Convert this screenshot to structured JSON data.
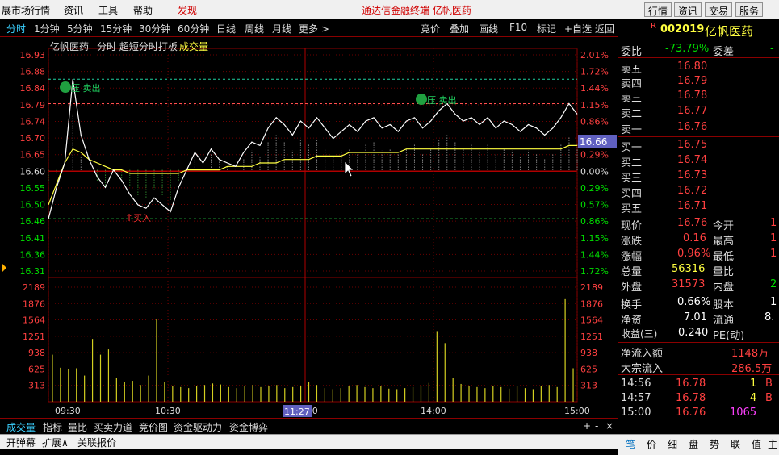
{
  "menubar": {
    "items": [
      "展市场行情",
      "资讯",
      "工具",
      "帮助",
      "发现"
    ],
    "title": "通达信金融终端  亿帆医药",
    "buttons": [
      "行情",
      "资讯",
      "交易",
      "服务"
    ]
  },
  "periods": [
    "分时",
    "1分钟",
    "5分钟",
    "15分钟",
    "30分钟",
    "60分钟",
    "日线",
    "周线",
    "月线",
    "更多 >"
  ],
  "toolbar": [
    "竞价",
    "叠加",
    "画线",
    "F10",
    "标记",
    "+自选",
    "返回"
  ],
  "chart": {
    "stock_name": "亿帆医药",
    "view_label": "分时 超短分时打板",
    "volume_label": "成交量",
    "current_price_tag": "16.66",
    "cursor_time_tag": "11:27",
    "annotations": [
      "压  卖出",
      "买入",
      "压  卖出"
    ]
  },
  "chart_data": {
    "type": "line",
    "price_axis": [
      "16.93",
      "16.88",
      "16.84",
      "16.79",
      "16.74",
      "16.70",
      "16.65",
      "16.60",
      "16.55",
      "16.50",
      "16.46",
      "16.41",
      "16.36",
      "16.31"
    ],
    "pct_axis": [
      "2.01%",
      "1.72%",
      "1.44%",
      "1.15%",
      "0.86%",
      "0.57%",
      "0.29%",
      "0.00%",
      "0.29%",
      "0.57%",
      "0.86%",
      "1.15%",
      "1.44%",
      "1.72%"
    ],
    "volume_axis": [
      "2189",
      "1876",
      "1564",
      "1251",
      "938",
      "625",
      "313"
    ],
    "time_axis": [
      "09:30",
      "10:30",
      "13:00",
      "14:00",
      "15:00"
    ],
    "ylim": [
      16.31,
      16.93
    ],
    "pre_close": 16.6,
    "price": [
      16.46,
      16.55,
      16.62,
      16.86,
      16.7,
      16.63,
      16.58,
      16.55,
      16.6,
      16.57,
      16.53,
      16.5,
      16.49,
      16.52,
      16.5,
      16.48,
      16.55,
      16.6,
      16.65,
      16.62,
      16.66,
      16.63,
      16.62,
      16.61,
      16.65,
      16.68,
      16.67,
      16.72,
      16.75,
      16.73,
      16.7,
      16.74,
      16.72,
      16.75,
      16.72,
      16.69,
      16.71,
      16.73,
      16.71,
      16.74,
      16.75,
      16.72,
      16.73,
      16.71,
      16.74,
      16.75,
      16.72,
      16.74,
      16.77,
      16.79,
      16.76,
      16.74,
      16.75,
      16.73,
      16.75,
      16.72,
      16.74,
      16.73,
      16.71,
      16.73,
      16.72,
      16.7,
      16.72,
      16.75,
      16.79,
      16.76
    ],
    "avg_price": [
      16.5,
      16.56,
      16.62,
      16.66,
      16.65,
      16.63,
      16.62,
      16.61,
      16.6,
      16.6,
      16.59,
      16.59,
      16.59,
      16.59,
      16.59,
      16.59,
      16.59,
      16.6,
      16.6,
      16.6,
      16.6,
      16.6,
      16.61,
      16.61,
      16.61,
      16.61,
      16.62,
      16.62,
      16.62,
      16.63,
      16.63,
      16.63,
      16.63,
      16.64,
      16.64,
      16.64,
      16.64,
      16.65,
      16.65,
      16.65,
      16.65,
      16.65,
      16.65,
      16.65,
      16.66,
      16.66,
      16.66,
      16.66,
      16.66,
      16.66,
      16.66,
      16.66,
      16.66,
      16.66,
      16.66,
      16.66,
      16.66,
      16.66,
      16.66,
      16.66,
      16.66,
      16.66,
      16.66,
      16.66,
      16.67,
      16.67
    ],
    "volume": [
      900,
      650,
      620,
      640,
      500,
      1200,
      900,
      1000,
      450,
      380,
      400,
      320,
      500,
      1580,
      380,
      300,
      280,
      260,
      300,
      320,
      350,
      330,
      280,
      260,
      300,
      320,
      280,
      300,
      320,
      260,
      280,
      300,
      380,
      320,
      260,
      240,
      260,
      300,
      320,
      280,
      260,
      300,
      250,
      240,
      260,
      280,
      300,
      360,
      1350,
      1120,
      460,
      340,
      300,
      280,
      260,
      300,
      280,
      250,
      300,
      260,
      240,
      300,
      320,
      280,
      1960,
      640
    ]
  },
  "bottom_tabs": [
    "成交量",
    "指标",
    "量比",
    "买卖力道",
    "竞价图",
    "资金驱动力",
    "资金博弈"
  ],
  "bottom_tabs2": [
    "开弹幕",
    "扩展∧",
    "关联报价"
  ],
  "quote": {
    "flag": "R",
    "code": "002019",
    "name": "亿帆医药",
    "weibi_label": "委比",
    "weibi_value": "-73.79%",
    "weicha_label": "委差",
    "weicha_value": "-",
    "sell": [
      {
        "label": "卖五",
        "price": "16.80"
      },
      {
        "label": "卖四",
        "price": "16.79"
      },
      {
        "label": "卖三",
        "price": "16.78"
      },
      {
        "label": "卖二",
        "price": "16.77"
      },
      {
        "label": "卖一",
        "price": "16.76"
      }
    ],
    "buy": [
      {
        "label": "买一",
        "price": "16.75"
      },
      {
        "label": "买二",
        "price": "16.74"
      },
      {
        "label": "买三",
        "price": "16.73"
      },
      {
        "label": "买四",
        "price": "16.72"
      },
      {
        "label": "买五",
        "price": "16.71"
      }
    ],
    "stats": [
      {
        "label": "现价",
        "value": "16.76",
        "label2": "今开",
        "value2": "1"
      },
      {
        "label": "涨跌",
        "value": "0.16",
        "label2": "最高",
        "value2": "1"
      },
      {
        "label": "涨幅",
        "value": "0.96%",
        "label2": "最低",
        "value2": "1"
      },
      {
        "label": "总量",
        "value": "56316",
        "label2": "量比",
        "value2": ""
      },
      {
        "label": "外盘",
        "value": "31573",
        "label2": "内盘",
        "value2": "2"
      }
    ],
    "stats2": [
      {
        "label": "换手",
        "value": "0.66%",
        "label2": "股本",
        "value2": "1"
      },
      {
        "label": "净资",
        "value": "7.01",
        "label2": "流通",
        "value2": "8."
      },
      {
        "label": "收益(三)",
        "value": "0.240",
        "label2": "PE(动)",
        "value2": ""
      }
    ],
    "flow": [
      {
        "label": "净流入额",
        "value": "1148万"
      },
      {
        "label": "大宗流入",
        "value": "286.5万"
      }
    ],
    "ticks": [
      {
        "time": "14:56",
        "price": "16.78",
        "vol": "1",
        "side": "B"
      },
      {
        "time": "14:57",
        "price": "16.78",
        "vol": "4",
        "side": "B"
      },
      {
        "time": "15:00",
        "price": "16.76",
        "vol": "1065",
        "side": ""
      }
    ],
    "bottom_tabs": [
      "笔",
      "价",
      "细",
      "盘",
      "势",
      "联",
      "值",
      "主"
    ]
  }
}
